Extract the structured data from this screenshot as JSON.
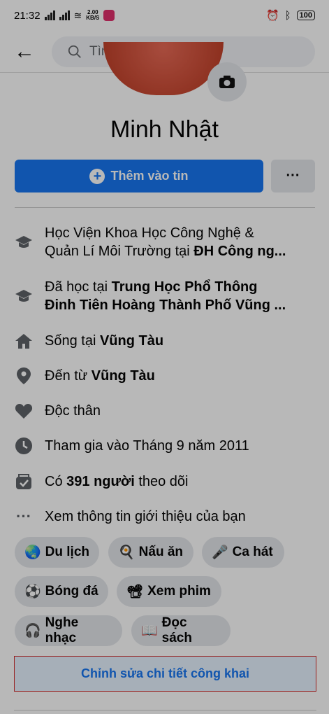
{
  "status": {
    "time": "21:32",
    "speed_value": "2.00",
    "speed_unit": "KB/S",
    "battery": "100"
  },
  "header": {
    "search_placeholder": "Tìm kiếm"
  },
  "profile": {
    "name": "Minh Nhật"
  },
  "actions": {
    "add_story": "Thêm vào tin",
    "more": "···"
  },
  "intro": [
    {
      "icon": "graduation-cap-icon",
      "text_a": "Học Viện Khoa Học Công Nghệ &",
      "text_b": "Quản Lí Môi Trường tại",
      "bold": "ĐH Công ng..."
    },
    {
      "icon": "graduation-cap-icon",
      "text_a": "Đã học tại",
      "bold_a": "Trung Học Phổ Thông",
      "bold_b": "Đinh Tiên Hoàng Thành Phố Vũng ..."
    },
    {
      "icon": "home-icon",
      "prefix": "Sống tại",
      "bold": "Vũng Tàu"
    },
    {
      "icon": "location-pin-icon",
      "prefix": "Đến từ",
      "bold": "Vũng Tàu"
    },
    {
      "icon": "heart-icon",
      "text": "Độc thân"
    },
    {
      "icon": "clock-icon",
      "text": "Tham gia vào Tháng 9 năm 2011"
    },
    {
      "icon": "followers-icon",
      "prefix": "Có",
      "bold": "391 người",
      "suffix": "theo dõi"
    },
    {
      "icon": "more-dots-icon",
      "text": "Xem thông tin giới thiệu của bạn"
    }
  ],
  "hobbies": [
    {
      "emoji": "🌏",
      "label": "Du lịch"
    },
    {
      "emoji": "🍳",
      "label": "Nấu ăn"
    },
    {
      "emoji": "🎤",
      "label": "Ca hát"
    },
    {
      "emoji": "⚽",
      "label": "Bóng đá"
    },
    {
      "emoji": "📽",
      "label": "Xem phim"
    },
    {
      "emoji": "🎧",
      "label": "Nghe nhạc"
    },
    {
      "emoji": "📖",
      "label": "Đọc sách"
    }
  ],
  "edit_public_details": "Chỉnh sửa chi tiết công khai"
}
